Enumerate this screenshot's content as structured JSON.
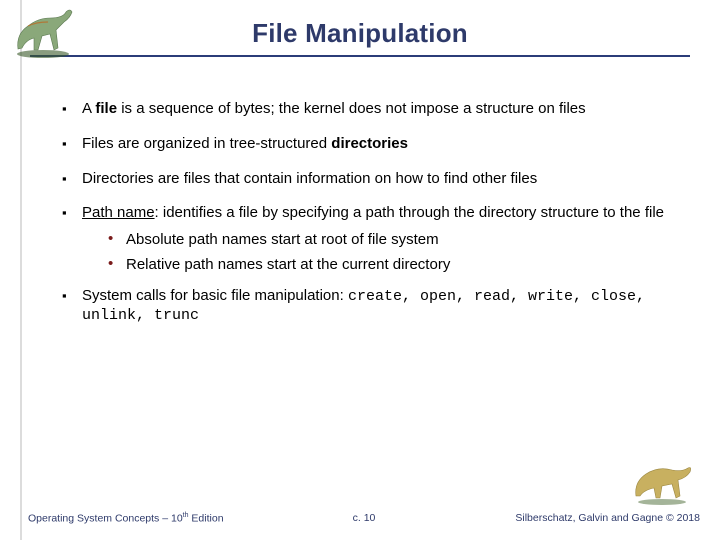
{
  "title": "File Manipulation",
  "bullets": {
    "b1_pre": "A ",
    "b1_bold": "file",
    "b1_post": " is a sequence of bytes; the kernel does not impose a structure on files",
    "b2_pre": "Files are organized in tree-structured ",
    "b2_bold": "directories",
    "b3": "Directories are files that contain information on how to find other files",
    "b4_u": "Path name",
    "b4_post": ":  identifies a file by specifying a path through the directory structure to the file",
    "b4_sub1": "Absolute path names start at root of file system",
    "b4_sub2": "Relative path names start at the current directory",
    "b5_pre": "System calls for basic file manipulation: ",
    "b5_code": "create, open, read, write, close, unlink, trunc"
  },
  "footer": {
    "left_pre": "Operating System Concepts – 10",
    "left_sup": "th",
    "left_post": " Edition",
    "center": "c. 10",
    "right": "Silberschatz, Galvin and Gagne © 2018"
  }
}
